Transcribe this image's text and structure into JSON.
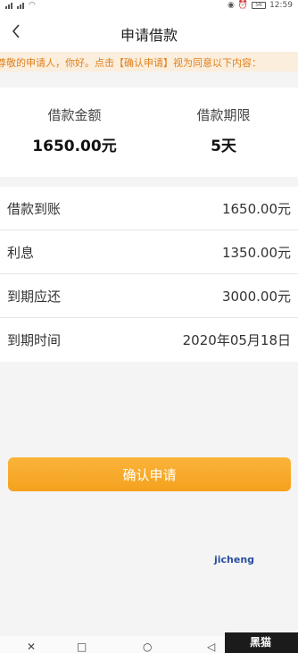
{
  "status_bar": {
    "time": "12:59",
    "battery": "56"
  },
  "nav": {
    "title": "申请借款"
  },
  "notice": {
    "text": "尊敬的申请人，你好。点击【确认申请】视为同意以下内容："
  },
  "summary": {
    "amount_label": "借款金额",
    "amount_value": "1650.00元",
    "term_label": "借款期限",
    "term_value": "5天"
  },
  "details": [
    {
      "label": "借款到账",
      "value": "1650.00元"
    },
    {
      "label": "利息",
      "value": "1350.00元"
    },
    {
      "label": "到期应还",
      "value": "3000.00元"
    },
    {
      "label": "到期时间",
      "value": "2020年05月18日"
    }
  ],
  "confirm_button": {
    "label": "确认申请"
  },
  "watermark": {
    "text": "jicheng"
  },
  "logo": {
    "text": "黑猫"
  },
  "colors": {
    "accent": "#f5a623",
    "notice_text": "#e0801b",
    "notice_bg": "#fbeedd"
  }
}
